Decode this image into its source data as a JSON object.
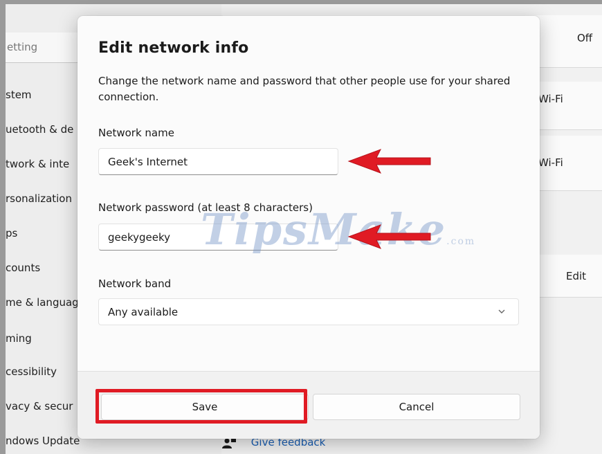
{
  "background": {
    "search_placeholder": "etting",
    "nav_items": [
      "stem",
      "uetooth & de",
      "twork & inte",
      "rsonalization",
      "ps",
      "counts",
      "me & languag",
      "ming",
      "cessibility",
      "vacy & secur",
      "ndows Update"
    ],
    "right": {
      "off_label": "Off",
      "wifi_label_1": "Wi-Fi",
      "wifi_label_2": "Wi-Fi",
      "edit_label": "Edit"
    },
    "feedback_label": "Give feedback"
  },
  "dialog": {
    "title": "Edit network info",
    "description": "Change the network name and password that other people use for your shared connection.",
    "network_name_label": "Network name",
    "network_name_value": "Geek's Internet",
    "password_label": "Network password (at least 8 characters)",
    "password_value": "geekygeeky",
    "band_label": "Network band",
    "band_value": "Any available",
    "save_label": "Save",
    "cancel_label": "Cancel"
  },
  "annotations": {
    "arrow_color": "#e01b24",
    "highlight_color": "#e01b24"
  },
  "watermark": {
    "text": "TipsMake",
    "suffix": ".com"
  }
}
